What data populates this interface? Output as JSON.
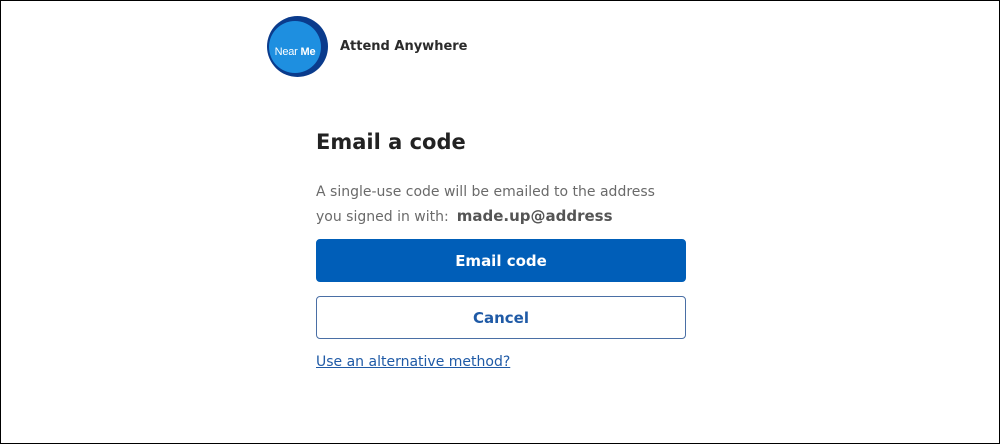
{
  "header": {
    "logo_text_regular": "Near",
    "logo_text_bold": "Me",
    "app_name": "Attend Anywhere"
  },
  "main": {
    "title": "Email a code",
    "description_line1": "A single-use code will be emailed to the address",
    "description_line2": "you signed in with:",
    "email_address": "made.up@address",
    "primary_button_label": "Email code",
    "secondary_button_label": "Cancel",
    "alternative_link_label": "Use an alternative method?"
  },
  "colors": {
    "primary": "#005eb8",
    "logo_dark": "#0a3b8c",
    "logo_light": "#1e8fe0",
    "link": "#1f5aa6"
  }
}
